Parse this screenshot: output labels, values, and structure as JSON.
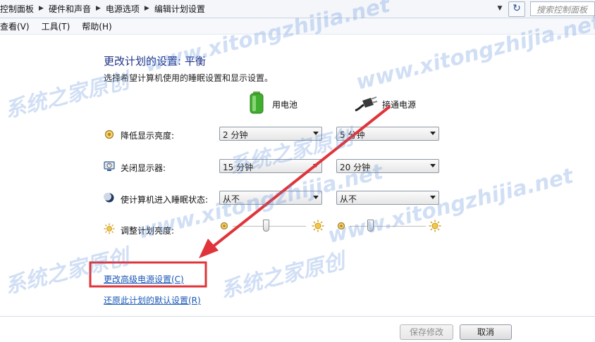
{
  "address_bar": {
    "crumbs": [
      "控制面板",
      "硬件和声音",
      "电源选项",
      "编辑计划设置"
    ],
    "search_placeholder": "搜索控制面板"
  },
  "menu": [
    "查看(V)",
    "工具(T)",
    "帮助(H)"
  ],
  "page": {
    "title": "更改计划的设置: 平衡",
    "subtitle": "选择希望计算机使用的睡眠设置和显示设置。",
    "col_battery": "用电池",
    "col_plugged": "接通电源"
  },
  "settings": [
    {
      "label": "降低显示亮度:",
      "battery": "2 分钟",
      "plugged": "5 分钟"
    },
    {
      "label": "关闭显示器:",
      "battery": "15 分钟",
      "plugged": "20 分钟"
    },
    {
      "label": "使计算机进入睡眠状态:",
      "battery": "从不",
      "plugged": "从不"
    }
  ],
  "brightness": {
    "label": "调整计划亮度:",
    "battery_level": 0.45,
    "plugged_level": 0.25
  },
  "links": {
    "advanced": "更改高级电源设置(C)",
    "restore": "还原此计划的默认设置(R)"
  },
  "buttons": {
    "save": "保存修改",
    "cancel": "取消"
  },
  "watermark": {
    "cn": "系统之家原创",
    "url": "www.xitongzhijia.net"
  },
  "colors": {
    "annotation_red": "#e0343a",
    "title_blue": "#1e3287",
    "link_blue": "#1a58b8"
  }
}
